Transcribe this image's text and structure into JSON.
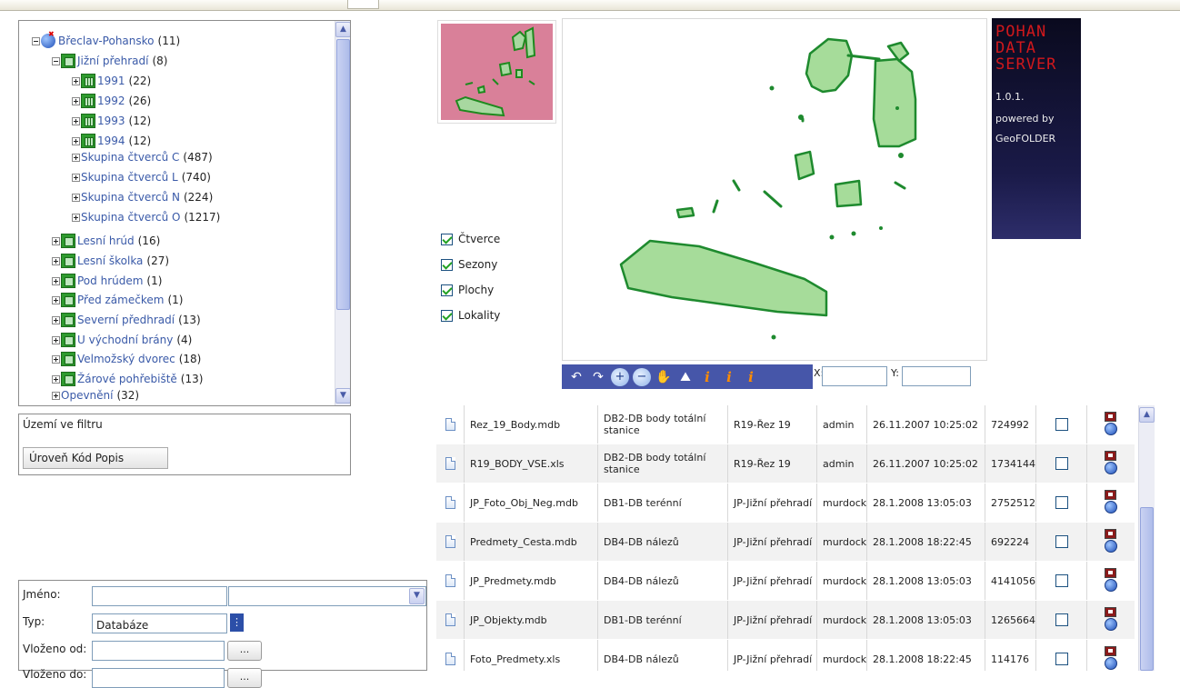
{
  "tree": {
    "items": [
      {
        "label": "Břeclav-Pohansko",
        "count": "(11)"
      },
      {
        "label": "Jižní přehradí",
        "count": "(8)"
      },
      {
        "label": "1991",
        "count": "(22)"
      },
      {
        "label": "1992",
        "count": "(26)"
      },
      {
        "label": "1993",
        "count": "(12)"
      },
      {
        "label": "1994",
        "count": "(12)"
      },
      {
        "label": "Skupina čtverců C",
        "count": "(487)"
      },
      {
        "label": "Skupina čtverců L",
        "count": "(740)"
      },
      {
        "label": "Skupina čtverců N",
        "count": "(224)"
      },
      {
        "label": "Skupina čtverců O",
        "count": "(1217)"
      },
      {
        "label": "Lesní hrúd",
        "count": "(16)"
      },
      {
        "label": "Lesní školka",
        "count": "(27)"
      },
      {
        "label": "Pod hrúdem",
        "count": "(1)"
      },
      {
        "label": "Před zámečkem",
        "count": "(1)"
      },
      {
        "label": "Severní předhradí",
        "count": "(13)"
      },
      {
        "label": "U východní brány",
        "count": "(4)"
      },
      {
        "label": "Velmožský dvorec",
        "count": "(18)"
      },
      {
        "label": "Žárové pohřebiště",
        "count": "(13)"
      },
      {
        "label": "Opevnění",
        "count": "(32)"
      }
    ]
  },
  "filter": {
    "title": "Území ve filtru",
    "header_button": "Úroveň Kód Popis"
  },
  "form": {
    "name_label": "Jméno:",
    "type_label": "Typ:",
    "type_value": "Databáze",
    "inserted_from_label": "Vloženo od:",
    "browse_label": "...",
    "inserted_to_label": "Vloženo do:"
  },
  "layers": {
    "items": [
      {
        "label": "Čtverce",
        "checked": true
      },
      {
        "label": "Sezony",
        "checked": true
      },
      {
        "label": "Plochy",
        "checked": true
      },
      {
        "label": "Lokality",
        "checked": true
      }
    ]
  },
  "logo": {
    "line1": "POHAN",
    "line2": "DATA",
    "line3": "SERVER",
    "version": "1.0.1.",
    "powered": "powered by",
    "product": "GeoFOLDER"
  },
  "map_toolbar": {
    "x_label": "X:",
    "y_label": "Y:",
    "x_value": "",
    "y_value": ""
  },
  "files": [
    {
      "name": "Rez_19_Body.mdb",
      "db": "DB2-DB body totální stanice",
      "location": "R19-Řez 19",
      "user": "admin",
      "date": "26.11.2007 10:25:02",
      "size": "724992"
    },
    {
      "name": "R19_BODY_VSE.xls",
      "db": "DB2-DB body totální stanice",
      "location": "R19-Řez 19",
      "user": "admin",
      "date": "26.11.2007 10:25:02",
      "size": "1734144"
    },
    {
      "name": "JP_Foto_Obj_Neg.mdb",
      "db": "DB1-DB terénní",
      "location": "JP-Jižní přehradí",
      "user": "murdock",
      "date": "28.1.2008 13:05:03",
      "size": "2752512"
    },
    {
      "name": "Predmety_Cesta.mdb",
      "db": "DB4-DB nálezů",
      "location": "JP-Jižní přehradí",
      "user": "murdock",
      "date": "28.1.2008 18:22:45",
      "size": "692224"
    },
    {
      "name": "JP_Predmety.mdb",
      "db": "DB4-DB nálezů",
      "location": "JP-Jižní přehradí",
      "user": "murdock",
      "date": "28.1.2008 13:05:03",
      "size": "4141056"
    },
    {
      "name": "JP_Objekty.mdb",
      "db": "DB1-DB terénní",
      "location": "JP-Jižní přehradí",
      "user": "murdock",
      "date": "28.1.2008 13:05:03",
      "size": "1265664"
    },
    {
      "name": "Foto_Predmety.xls",
      "db": "DB4-DB nálezů",
      "location": "JP-Jižní přehradí",
      "user": "murdock",
      "date": "28.1.2008 18:22:45",
      "size": "114176"
    }
  ]
}
